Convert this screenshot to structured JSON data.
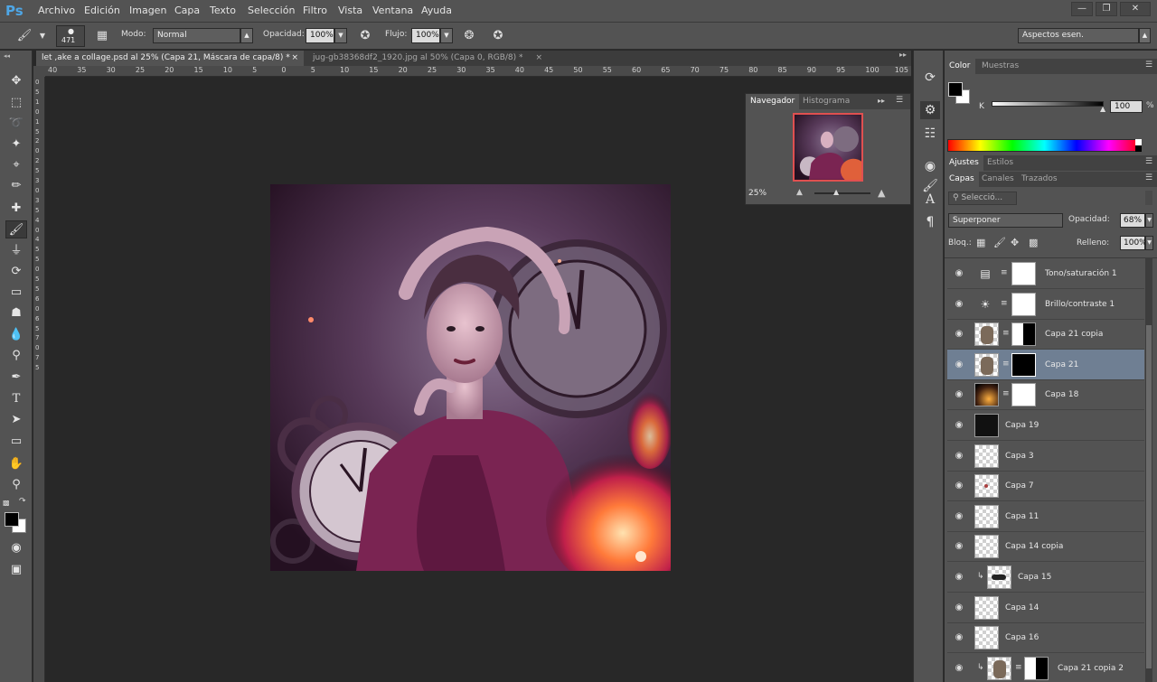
{
  "app": {
    "logo": "Ps",
    "menu": [
      "Archivo",
      "Edición",
      "Imagen",
      "Capa",
      "Texto",
      "Selección",
      "Filtro",
      "Vista",
      "Ventana",
      "Ayuda"
    ]
  },
  "options_bar": {
    "brush_size": "471",
    "mode_label": "Modo:",
    "mode_value": "Normal",
    "opacity_label": "Opacidad:",
    "opacity_value": "100%",
    "flow_label": "Flujo:",
    "flow_value": "100%",
    "workspace": "Aspectos esen."
  },
  "tabs": [
    {
      "label": "let ,ake a collage.psd al 25% (Capa 21, Máscara de capa/8) *",
      "active": true
    },
    {
      "label": "jug-gb38368df2_1920.jpg al 50% (Capa 0, RGB/8) *",
      "active": false
    }
  ],
  "close_glyph": "×",
  "ruler_top": [
    "40",
    "35",
    "30",
    "25",
    "20",
    "15",
    "10",
    "5",
    "0",
    "5",
    "10",
    "15",
    "20",
    "25",
    "30",
    "35",
    "40",
    "45",
    "50",
    "55",
    "60",
    "65",
    "70",
    "75",
    "80",
    "85",
    "90",
    "95",
    "100",
    "105"
  ],
  "ruler_left": [
    "0",
    "5",
    "1",
    "0",
    "1",
    "5",
    "2",
    "0",
    "2",
    "5",
    "3",
    "0",
    "3",
    "5",
    "4",
    "0",
    "4",
    "5",
    "5",
    "0",
    "5",
    "5",
    "6",
    "0",
    "6",
    "5",
    "7",
    "0",
    "7",
    "5"
  ],
  "navigator": {
    "tabs": [
      "Navegador",
      "Histograma"
    ],
    "zoom": "25%"
  },
  "color_panel": {
    "tabs": [
      "Color",
      "Muestras"
    ],
    "channel": "K",
    "value": "100",
    "fg_color": "#000000",
    "bg_color": "#ffffff"
  },
  "adjust_panel": {
    "tabs": [
      "Ajustes",
      "Estilos"
    ]
  },
  "layers_panel": {
    "tabs": [
      "Capas",
      "Canales",
      "Trazados"
    ],
    "filter_placeholder": "Selecció...",
    "blend_mode": "Superponer",
    "opacity_label": "Opacidad:",
    "opacity_value": "68%",
    "lock_label": "Bloq.:",
    "fill_label": "Relleno:",
    "fill_value": "100%",
    "layers": [
      {
        "name": "Tono/saturación 1",
        "kind": "adjustment",
        "icon": "hue-saturation-icon",
        "mask": "white",
        "selected": false
      },
      {
        "name": "Brillo/contraste 1",
        "kind": "adjustment",
        "icon": "brightness-contrast-icon",
        "mask": "white",
        "selected": false
      },
      {
        "name": "Capa 21 copia",
        "kind": "masked",
        "thumb": "person",
        "mask": "silhouette",
        "selected": false
      },
      {
        "name": "Capa 21",
        "kind": "masked",
        "thumb": "person",
        "mask": "black-dot",
        "selected": true
      },
      {
        "name": "Capa 18",
        "kind": "masked",
        "thumb": "fire",
        "mask": "white",
        "selected": false
      },
      {
        "name": "Capa 19",
        "kind": "plain",
        "thumb": "dark",
        "selected": false
      },
      {
        "name": "Capa 3",
        "kind": "plain",
        "thumb": "empty",
        "selected": false
      },
      {
        "name": "Capa 7",
        "kind": "plain",
        "thumb": "dot",
        "selected": false
      },
      {
        "name": "Capa 11",
        "kind": "plain",
        "thumb": "empty",
        "selected": false
      },
      {
        "name": "Capa 14 copia",
        "kind": "plain",
        "thumb": "empty",
        "selected": false
      },
      {
        "name": "Capa 15",
        "kind": "clipped",
        "thumb": "smudge",
        "selected": false
      },
      {
        "name": "Capa 14",
        "kind": "plain",
        "thumb": "empty",
        "selected": false
      },
      {
        "name": "Capa 16",
        "kind": "plain",
        "thumb": "empty",
        "selected": false
      },
      {
        "name": "Capa 21 copia 2",
        "kind": "clipped-masked",
        "thumb": "person",
        "mask": "silhouette",
        "selected": false
      }
    ]
  },
  "colors": {
    "selected_row": "#6f7f93",
    "accent": "#4ea6e6"
  }
}
